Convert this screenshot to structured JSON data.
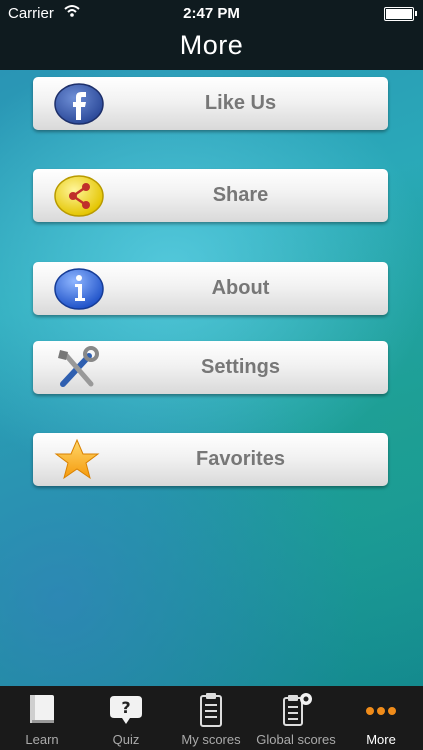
{
  "status_bar": {
    "carrier": "Carrier",
    "time": "2:47 PM"
  },
  "header": {
    "title": "More"
  },
  "menu": [
    {
      "label": "Like Us",
      "icon": "facebook-icon"
    },
    {
      "label": "Share",
      "icon": "share-icon"
    },
    {
      "label": "About",
      "icon": "info-icon"
    },
    {
      "label": "Settings",
      "icon": "settings-tools-icon"
    },
    {
      "label": "Favorites",
      "icon": "star-icon"
    }
  ],
  "tabs": [
    {
      "label": "Learn",
      "icon": "book-icon"
    },
    {
      "label": "Quiz",
      "icon": "question-icon"
    },
    {
      "label": "My scores",
      "icon": "clipboard-icon"
    },
    {
      "label": "Global scores",
      "icon": "global-clipboard-icon"
    },
    {
      "label": "More",
      "icon": "more-dots-icon",
      "active": true
    }
  ]
}
